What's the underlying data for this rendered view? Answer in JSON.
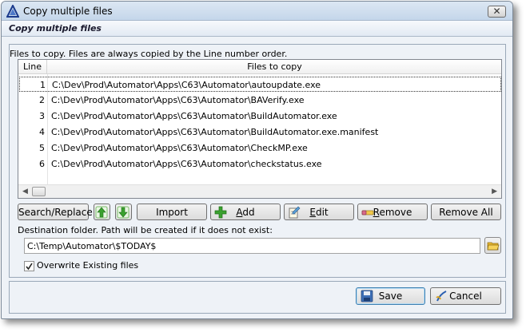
{
  "window": {
    "title": "Copy multiple files",
    "header": "Copy multiple files",
    "close_glyph": "✕",
    "icon": "triangle-logo-icon"
  },
  "files": {
    "label": "Files to copy.  Files are always copied by the Line number order.",
    "columns": [
      "Line",
      "Files to copy"
    ],
    "rows": [
      {
        "line": "1",
        "path": "C:\\Dev\\Prod\\Automator\\Apps\\C63\\Automator\\autoupdate.exe"
      },
      {
        "line": "2",
        "path": "C:\\Dev\\Prod\\Automator\\Apps\\C63\\Automator\\BAVerify.exe"
      },
      {
        "line": "3",
        "path": "C:\\Dev\\Prod\\Automator\\Apps\\C63\\Automator\\BuildAutomator.exe"
      },
      {
        "line": "4",
        "path": "C:\\Dev\\Prod\\Automator\\Apps\\C63\\Automator\\BuildAutomator.exe.manifest"
      },
      {
        "line": "5",
        "path": "C:\\Dev\\Prod\\Automator\\Apps\\C63\\Automator\\CheckMP.exe"
      },
      {
        "line": "6",
        "path": "C:\\Dev\\Prod\\Automator\\Apps\\C63\\Automator\\checkstatus.exe"
      }
    ],
    "selected_line": "1"
  },
  "toolbar": {
    "search_replace": "Search/Replace",
    "move_up_icon": "green-arrow-up-icon",
    "move_down_icon": "green-arrow-down-icon",
    "import": "Import",
    "add_prefix": "",
    "add_hotkey": "A",
    "add_rest": "dd",
    "edit_hotkey": "E",
    "edit_rest": "dit",
    "remove_hotkey": "R",
    "remove_rest": "emove",
    "remove_all": "Remove All"
  },
  "destination": {
    "label": "Destination folder.  Path will be created if it does not exist:",
    "value": "C:\\Temp\\Automator\\$TODAY$",
    "browse_icon": "folder-open-icon"
  },
  "overwrite": {
    "label": "Overwrite Existing files",
    "checked": true
  },
  "footer": {
    "save": "Save",
    "cancel": "Cancel"
  },
  "colors": {
    "window_bg": "#eef2f7",
    "arrow_green": "#3aa12f",
    "folder_yellow": "#e8b730"
  }
}
